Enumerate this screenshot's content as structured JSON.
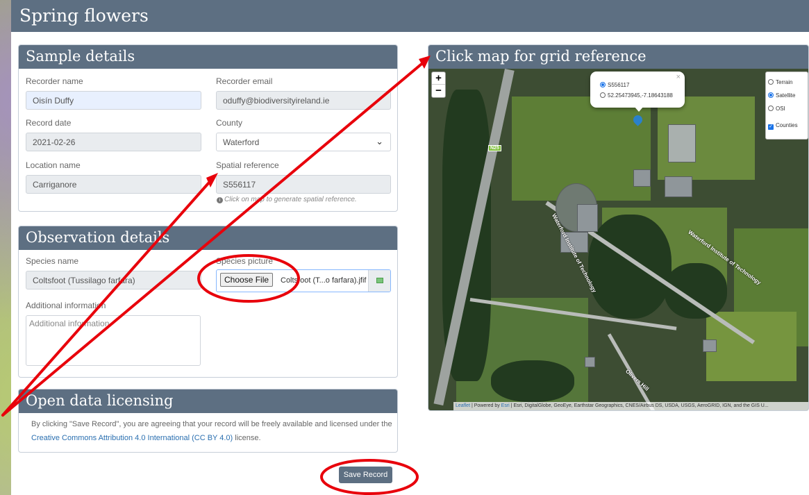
{
  "page": {
    "title": "Spring flowers"
  },
  "sample": {
    "title": "Sample details",
    "recorder_name": {
      "label": "Recorder name",
      "value": "Oisín Duffy"
    },
    "recorder_email": {
      "label": "Recorder email",
      "value": "oduffy@biodiversityireland.ie"
    },
    "record_date": {
      "label": "Record date",
      "value": "2021-02-26"
    },
    "county": {
      "label": "County",
      "value": "Waterford"
    },
    "location_name": {
      "label": "Location name",
      "value": "Carriganore"
    },
    "spatial_reference": {
      "label": "Spatial reference",
      "value": "S556117",
      "hint": "Click on map to generate spatial reference."
    }
  },
  "observation": {
    "title": "Observation details",
    "species_name": {
      "label": "Species name",
      "value": "Coltsfoot (Tussilago farfara)"
    },
    "species_picture": {
      "label": "Species picture",
      "button": "Choose File",
      "filename": "Coltsfoot (T...o farfara).jfif"
    },
    "additional_info": {
      "label": "Additional information",
      "placeholder": "Additional information"
    }
  },
  "licensing": {
    "title": "Open data licensing",
    "text_before": "By clicking \"Save Record\", you are agreeing that your record will be freely available and licensed under the",
    "link": "Creative Commons Attribution 4.0 International (CC BY 4.0)",
    "text_after": "license."
  },
  "save_button": "Save Record",
  "map": {
    "title": "Click map for grid reference",
    "zoom_in": "+",
    "zoom_out": "−",
    "layers": {
      "terrain": "Terrain",
      "satellite": "Satellite",
      "osi": "OSI",
      "counties": "Counties",
      "selected": "Satellite",
      "counties_checked": true
    },
    "popup": {
      "option1": "S556117",
      "option2": "52.25473945,-7.18643188",
      "close": "×"
    },
    "road_shield": "N25",
    "road_labels": [
      "Waterford Institute of Technology",
      "Waterford Institute of Technology",
      "Olivers Hill"
    ],
    "attribution": {
      "leaflet": "Leaflet",
      "powered": "| Powered by",
      "esri": "Esri",
      "rest": "| Esri, DigitalGlobe, GeoEye, Earthstar Geographics, CNES/Airbus DS, USDA, USGS, AeroGRID, IGN, and the GIS U..."
    }
  },
  "colors": {
    "header": "#5d6f82",
    "annotation": "#e8000b",
    "link": "#2a6fb0"
  }
}
